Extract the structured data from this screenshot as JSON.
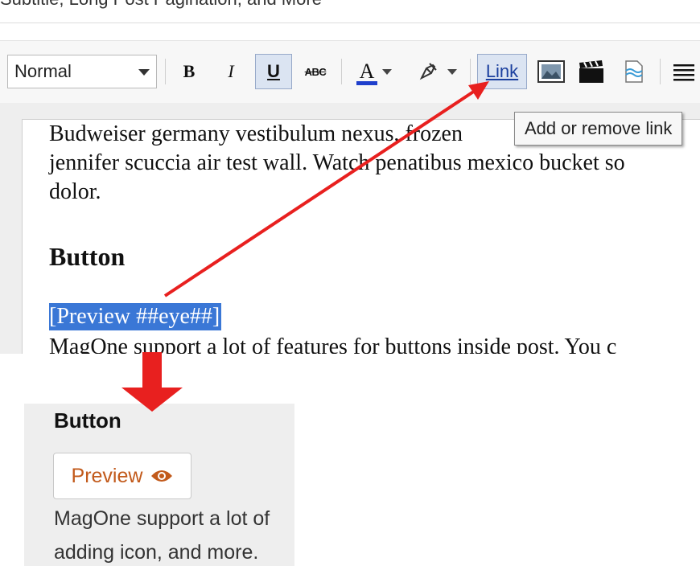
{
  "page": {
    "top_title": "Subtitle, Long Post Pagination, and More"
  },
  "toolbar": {
    "format_select_value": "Normal",
    "bold_label": "B",
    "italic_label": "I",
    "underline_label": "U",
    "strike_label": "ABC",
    "text_color_label": "A",
    "link_label": "Link",
    "tooltip": "Add or remove link",
    "colors": {
      "text_color_bar": "#1f3fcc",
      "pressed_bg": "#dbe4f2"
    }
  },
  "editor": {
    "paragraph_lines": [
      "Budweiser germany vestibulum nexus, frozen",
      "jennifer scuccia air test wall. Watch penatibus mexico bucket so",
      "dolor."
    ],
    "heading": "Button",
    "selected_text": "[Preview ##eye##]",
    "after_text": "MagOne support a lot of features for buttons inside post. You c",
    "selection_color": "#3a77d6"
  },
  "preview": {
    "heading": "Button",
    "button_label": "Preview",
    "button_icon": "eye-icon",
    "text_lines": [
      "MagOne support a lot of",
      "adding icon, and more."
    ],
    "button_text_color": "#c25a1b"
  },
  "annotations": {
    "arrow_color": "#e8201f"
  }
}
